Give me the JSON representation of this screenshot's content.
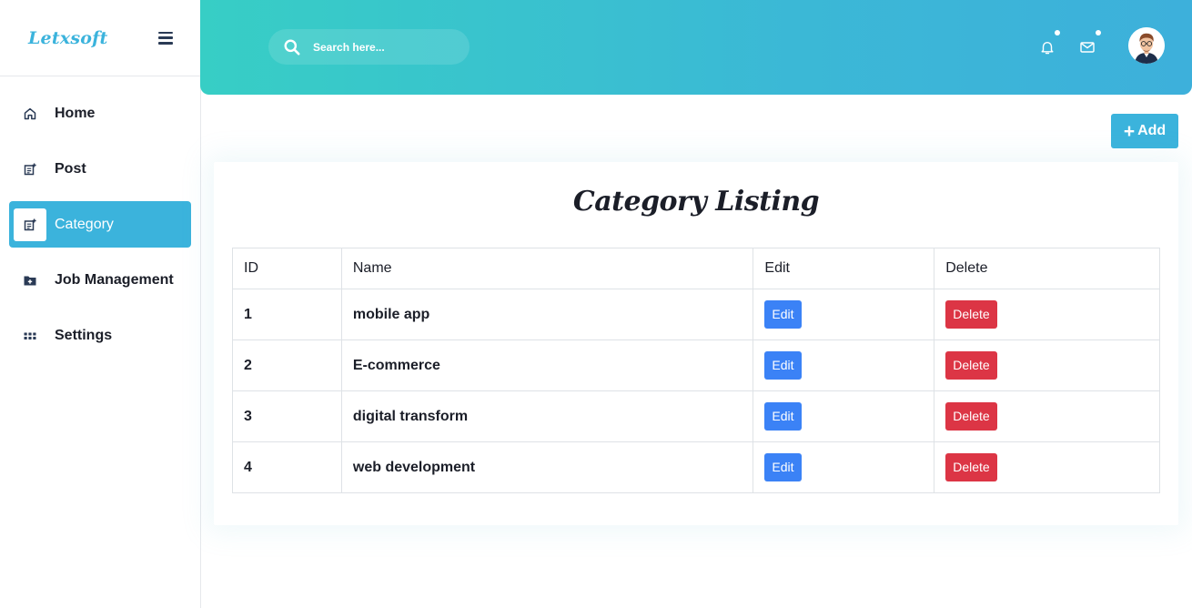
{
  "brand": "Letxsoft",
  "sidebar": {
    "items": [
      {
        "label": "Home",
        "icon": "home-icon",
        "active": false
      },
      {
        "label": "Post",
        "icon": "post-icon",
        "active": false
      },
      {
        "label": "Category",
        "icon": "category-icon",
        "active": true
      },
      {
        "label": "Job Management",
        "icon": "folder-plus-icon",
        "active": false
      },
      {
        "label": "Settings",
        "icon": "grid-icon",
        "active": false
      }
    ]
  },
  "header": {
    "search_placeholder": "Search here...",
    "icons": [
      "bell-icon",
      "mail-icon"
    ]
  },
  "main": {
    "add_label": "Add",
    "title": "Category Listing",
    "table": {
      "columns": [
        "ID",
        "Name",
        "Edit",
        "Delete"
      ],
      "rows": [
        {
          "id": "1",
          "name": "mobile app",
          "edit": "Edit",
          "delete": "Delete"
        },
        {
          "id": "2",
          "name": "E-commerce",
          "edit": "Edit",
          "delete": "Delete"
        },
        {
          "id": "3",
          "name": "digital transform",
          "edit": "Edit",
          "delete": "Delete"
        },
        {
          "id": "4",
          "name": "web development",
          "edit": "Edit",
          "delete": "Delete"
        }
      ]
    }
  },
  "colors": {
    "accent": "#3bb3dc",
    "header_gradient_start": "#37cec5",
    "header_gradient_end": "#3db0db",
    "edit_button": "#3b82f6",
    "delete_button": "#dc3545"
  }
}
